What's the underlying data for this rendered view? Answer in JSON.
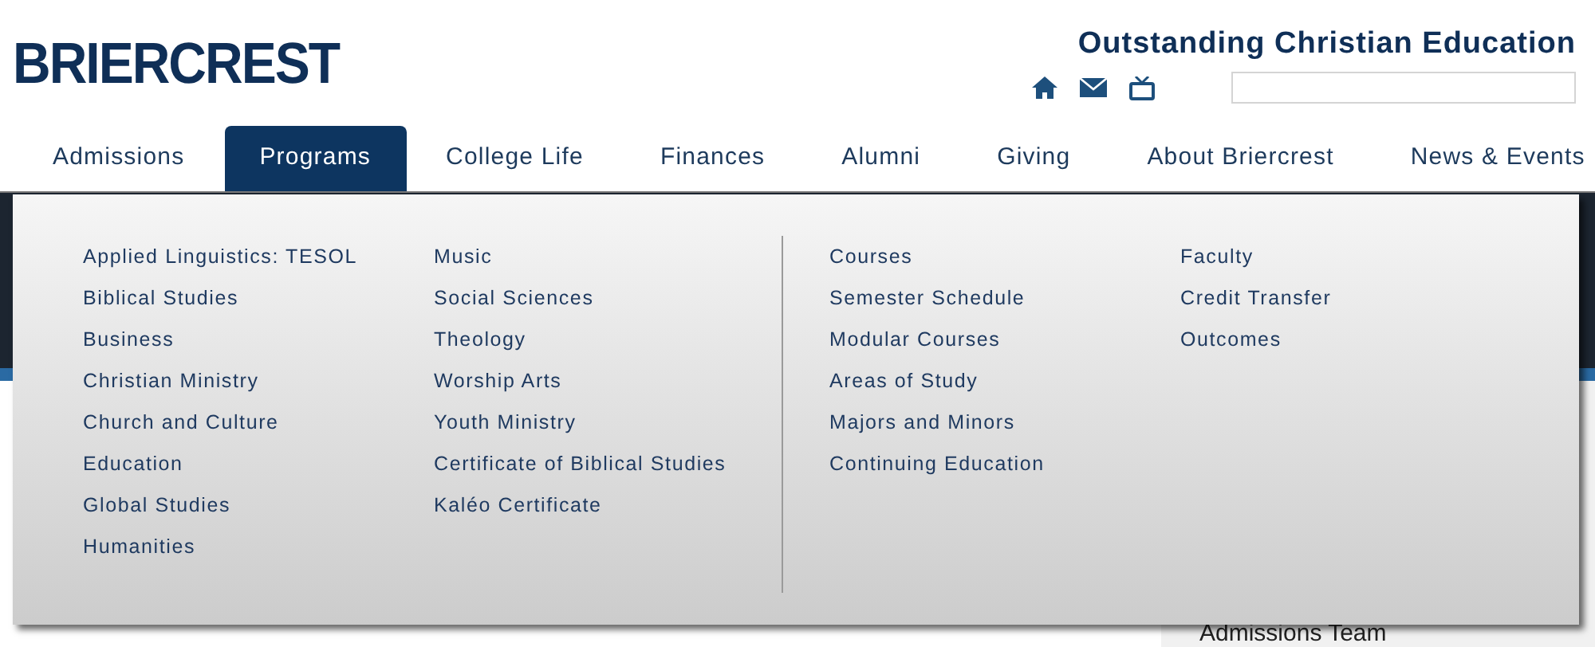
{
  "header": {
    "logo": "BRIERCREST",
    "tagline": "Outstanding Christian Education"
  },
  "nav": {
    "tabs": [
      {
        "label": "Admissions",
        "selected": false
      },
      {
        "label": "Programs",
        "selected": true
      },
      {
        "label": "College Life",
        "selected": false
      },
      {
        "label": "Finances",
        "selected": false
      },
      {
        "label": "Alumni",
        "selected": false
      },
      {
        "label": "Giving",
        "selected": false
      },
      {
        "label": "About Briercrest",
        "selected": false
      },
      {
        "label": "News & Events",
        "selected": false
      }
    ]
  },
  "dropdown": {
    "columns": [
      [
        "Applied Linguistics: TESOL",
        "Biblical Studies",
        "Business",
        "Christian Ministry",
        "Church and Culture",
        "Education",
        "Global Studies",
        "Humanities"
      ],
      [
        "Music",
        "Social Sciences",
        "Theology",
        "Worship Arts",
        "Youth Ministry",
        "Certificate of Biblical Studies",
        "Kaléo Certificate"
      ],
      [
        "Courses",
        "Semester Schedule",
        "Modular Courses",
        "Areas of Study",
        "Majors and Minors",
        "Continuing Education"
      ],
      [
        "Faculty",
        "Credit Transfer",
        "Outcomes"
      ]
    ]
  },
  "sidebar": {
    "link": "Admissions Team"
  }
}
